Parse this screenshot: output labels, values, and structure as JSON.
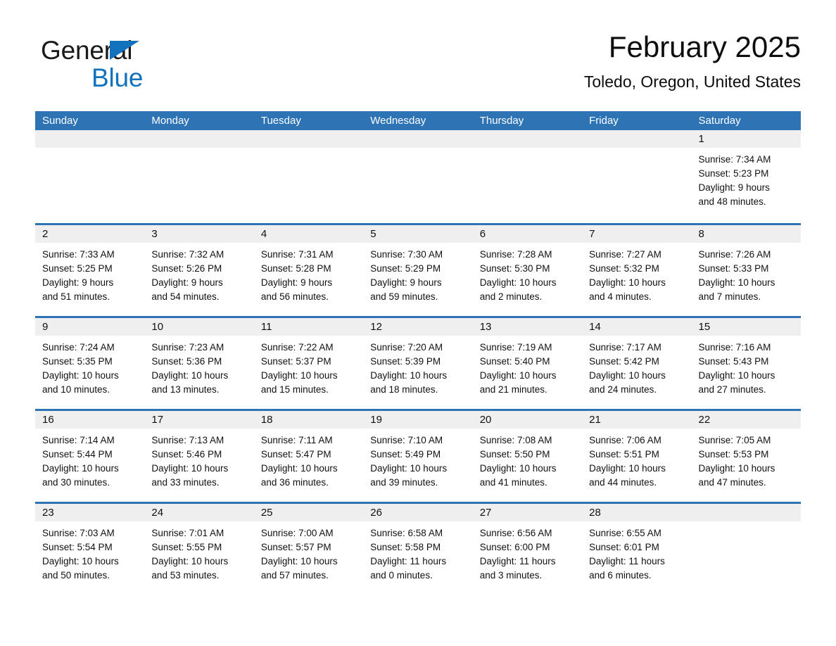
{
  "brand": {
    "name_part1": "General",
    "name_part2": "Blue",
    "logo_icon": "blue-triangle-logo",
    "accent_color": "#1272bd"
  },
  "header": {
    "title": "February 2025",
    "subtitle": "Toledo, Oregon, United States"
  },
  "calendar": {
    "header_bg": "#2e74b5",
    "daynum_bg": "#efefef",
    "weekdays": [
      "Sunday",
      "Monday",
      "Tuesday",
      "Wednesday",
      "Thursday",
      "Friday",
      "Saturday"
    ],
    "weeks": [
      [
        {
          "day": "",
          "empty": true
        },
        {
          "day": "",
          "empty": true
        },
        {
          "day": "",
          "empty": true
        },
        {
          "day": "",
          "empty": true
        },
        {
          "day": "",
          "empty": true
        },
        {
          "day": "",
          "empty": true
        },
        {
          "day": "1",
          "sunrise": "Sunrise: 7:34 AM",
          "sunset": "Sunset: 5:23 PM",
          "daylight1": "Daylight: 9 hours",
          "daylight2": "and 48 minutes."
        }
      ],
      [
        {
          "day": "2",
          "sunrise": "Sunrise: 7:33 AM",
          "sunset": "Sunset: 5:25 PM",
          "daylight1": "Daylight: 9 hours",
          "daylight2": "and 51 minutes."
        },
        {
          "day": "3",
          "sunrise": "Sunrise: 7:32 AM",
          "sunset": "Sunset: 5:26 PM",
          "daylight1": "Daylight: 9 hours",
          "daylight2": "and 54 minutes."
        },
        {
          "day": "4",
          "sunrise": "Sunrise: 7:31 AM",
          "sunset": "Sunset: 5:28 PM",
          "daylight1": "Daylight: 9 hours",
          "daylight2": "and 56 minutes."
        },
        {
          "day": "5",
          "sunrise": "Sunrise: 7:30 AM",
          "sunset": "Sunset: 5:29 PM",
          "daylight1": "Daylight: 9 hours",
          "daylight2": "and 59 minutes."
        },
        {
          "day": "6",
          "sunrise": "Sunrise: 7:28 AM",
          "sunset": "Sunset: 5:30 PM",
          "daylight1": "Daylight: 10 hours",
          "daylight2": "and 2 minutes."
        },
        {
          "day": "7",
          "sunrise": "Sunrise: 7:27 AM",
          "sunset": "Sunset: 5:32 PM",
          "daylight1": "Daylight: 10 hours",
          "daylight2": "and 4 minutes."
        },
        {
          "day": "8",
          "sunrise": "Sunrise: 7:26 AM",
          "sunset": "Sunset: 5:33 PM",
          "daylight1": "Daylight: 10 hours",
          "daylight2": "and 7 minutes."
        }
      ],
      [
        {
          "day": "9",
          "sunrise": "Sunrise: 7:24 AM",
          "sunset": "Sunset: 5:35 PM",
          "daylight1": "Daylight: 10 hours",
          "daylight2": "and 10 minutes."
        },
        {
          "day": "10",
          "sunrise": "Sunrise: 7:23 AM",
          "sunset": "Sunset: 5:36 PM",
          "daylight1": "Daylight: 10 hours",
          "daylight2": "and 13 minutes."
        },
        {
          "day": "11",
          "sunrise": "Sunrise: 7:22 AM",
          "sunset": "Sunset: 5:37 PM",
          "daylight1": "Daylight: 10 hours",
          "daylight2": "and 15 minutes."
        },
        {
          "day": "12",
          "sunrise": "Sunrise: 7:20 AM",
          "sunset": "Sunset: 5:39 PM",
          "daylight1": "Daylight: 10 hours",
          "daylight2": "and 18 minutes."
        },
        {
          "day": "13",
          "sunrise": "Sunrise: 7:19 AM",
          "sunset": "Sunset: 5:40 PM",
          "daylight1": "Daylight: 10 hours",
          "daylight2": "and 21 minutes."
        },
        {
          "day": "14",
          "sunrise": "Sunrise: 7:17 AM",
          "sunset": "Sunset: 5:42 PM",
          "daylight1": "Daylight: 10 hours",
          "daylight2": "and 24 minutes."
        },
        {
          "day": "15",
          "sunrise": "Sunrise: 7:16 AM",
          "sunset": "Sunset: 5:43 PM",
          "daylight1": "Daylight: 10 hours",
          "daylight2": "and 27 minutes."
        }
      ],
      [
        {
          "day": "16",
          "sunrise": "Sunrise: 7:14 AM",
          "sunset": "Sunset: 5:44 PM",
          "daylight1": "Daylight: 10 hours",
          "daylight2": "and 30 minutes."
        },
        {
          "day": "17",
          "sunrise": "Sunrise: 7:13 AM",
          "sunset": "Sunset: 5:46 PM",
          "daylight1": "Daylight: 10 hours",
          "daylight2": "and 33 minutes."
        },
        {
          "day": "18",
          "sunrise": "Sunrise: 7:11 AM",
          "sunset": "Sunset: 5:47 PM",
          "daylight1": "Daylight: 10 hours",
          "daylight2": "and 36 minutes."
        },
        {
          "day": "19",
          "sunrise": "Sunrise: 7:10 AM",
          "sunset": "Sunset: 5:49 PM",
          "daylight1": "Daylight: 10 hours",
          "daylight2": "and 39 minutes."
        },
        {
          "day": "20",
          "sunrise": "Sunrise: 7:08 AM",
          "sunset": "Sunset: 5:50 PM",
          "daylight1": "Daylight: 10 hours",
          "daylight2": "and 41 minutes."
        },
        {
          "day": "21",
          "sunrise": "Sunrise: 7:06 AM",
          "sunset": "Sunset: 5:51 PM",
          "daylight1": "Daylight: 10 hours",
          "daylight2": "and 44 minutes."
        },
        {
          "day": "22",
          "sunrise": "Sunrise: 7:05 AM",
          "sunset": "Sunset: 5:53 PM",
          "daylight1": "Daylight: 10 hours",
          "daylight2": "and 47 minutes."
        }
      ],
      [
        {
          "day": "23",
          "sunrise": "Sunrise: 7:03 AM",
          "sunset": "Sunset: 5:54 PM",
          "daylight1": "Daylight: 10 hours",
          "daylight2": "and 50 minutes."
        },
        {
          "day": "24",
          "sunrise": "Sunrise: 7:01 AM",
          "sunset": "Sunset: 5:55 PM",
          "daylight1": "Daylight: 10 hours",
          "daylight2": "and 53 minutes."
        },
        {
          "day": "25",
          "sunrise": "Sunrise: 7:00 AM",
          "sunset": "Sunset: 5:57 PM",
          "daylight1": "Daylight: 10 hours",
          "daylight2": "and 57 minutes."
        },
        {
          "day": "26",
          "sunrise": "Sunrise: 6:58 AM",
          "sunset": "Sunset: 5:58 PM",
          "daylight1": "Daylight: 11 hours",
          "daylight2": "and 0 minutes."
        },
        {
          "day": "27",
          "sunrise": "Sunrise: 6:56 AM",
          "sunset": "Sunset: 6:00 PM",
          "daylight1": "Daylight: 11 hours",
          "daylight2": "and 3 minutes."
        },
        {
          "day": "28",
          "sunrise": "Sunrise: 6:55 AM",
          "sunset": "Sunset: 6:01 PM",
          "daylight1": "Daylight: 11 hours",
          "daylight2": "and 6 minutes."
        },
        {
          "day": "",
          "empty": true
        }
      ]
    ]
  }
}
